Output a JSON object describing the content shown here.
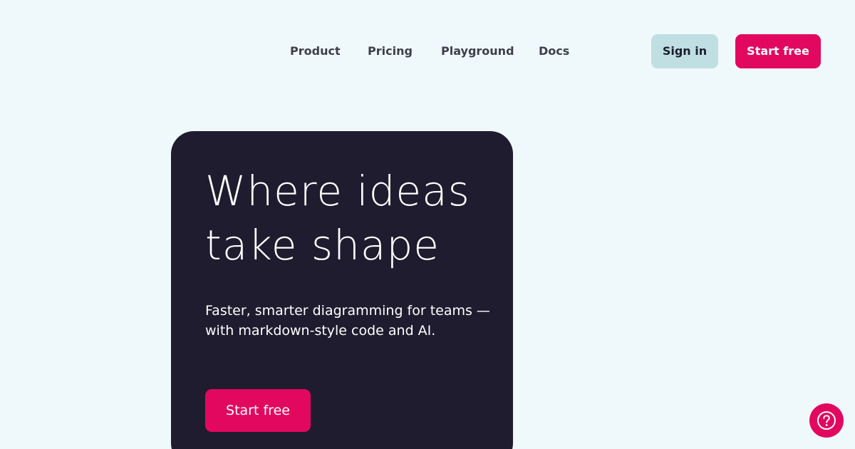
{
  "nav": {
    "links": [
      "Product",
      "Pricing",
      "Playground",
      "Docs"
    ],
    "sign_in": "Sign in",
    "start_free": "Start free"
  },
  "hero": {
    "title": "Where ideas take shape",
    "subtitle_line1": "Faster, smarter diagramming for teams —",
    "subtitle_line2": "with markdown-style code and AI.",
    "cta": "Start free"
  },
  "help": {
    "icon": "question-circle-icon"
  },
  "colors": {
    "background": "#eff8fa",
    "card": "#1e1c2e",
    "accent": "#e2085f",
    "sign_in_bg": "#bfdfe3",
    "nav_text": "#3d3f4a"
  }
}
